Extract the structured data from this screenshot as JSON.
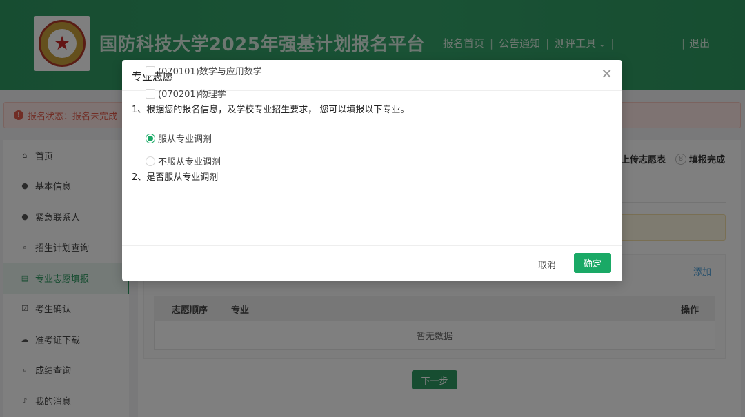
{
  "header": {
    "site_title": "国防科技大学2025年强基计划报名平台",
    "nav": [
      {
        "label": "报名首页"
      },
      {
        "label": "公告通知"
      },
      {
        "label": "测评工具"
      }
    ],
    "logout_label": "退出"
  },
  "status_bar": {
    "text": "报名状态：报名未完成"
  },
  "sidebar": {
    "items": [
      {
        "label": "首页",
        "icon": "home-icon"
      },
      {
        "label": "基本信息",
        "icon": "user-icon"
      },
      {
        "label": "紧急联系人",
        "icon": "user-icon"
      },
      {
        "label": "招生计划查询",
        "icon": "search-icon"
      },
      {
        "label": "专业志愿填报",
        "icon": "document-icon"
      },
      {
        "label": "考生确认",
        "icon": "checkbox-icon"
      },
      {
        "label": "准考证下载",
        "icon": "cloud-download-icon"
      },
      {
        "label": "成绩查询",
        "icon": "search-icon"
      },
      {
        "label": "我的消息",
        "icon": "bell-icon"
      }
    ]
  },
  "main": {
    "steps": [
      {
        "label": "上传志愿表"
      },
      {
        "number": "8",
        "label": "填报完成"
      }
    ],
    "add_label": "添加",
    "table": {
      "columns": [
        "志愿顺序",
        "专业",
        "操作"
      ],
      "empty_text": "暂无数据"
    },
    "next_label": "下一步"
  },
  "modal": {
    "title": "专业志愿",
    "q1": "1、根据您的报名信息，及学校专业招生要求， 您可以填报以下专业。",
    "majors": [
      {
        "label": "(070101)数学与应用数学",
        "checked": false
      },
      {
        "label": "(070201)物理学",
        "checked": false
      }
    ],
    "q2": "2、是否服从专业调剂",
    "adjust_options": [
      {
        "label": "服从专业调剂",
        "checked": true
      },
      {
        "label": "不服从专业调剂",
        "checked": false
      }
    ],
    "cancel_label": "取消",
    "ok_label": "确定"
  },
  "colors": {
    "brand_green": "#2f9a63",
    "confirm_green": "#1aa966",
    "alert_red": "#e25b4b"
  }
}
